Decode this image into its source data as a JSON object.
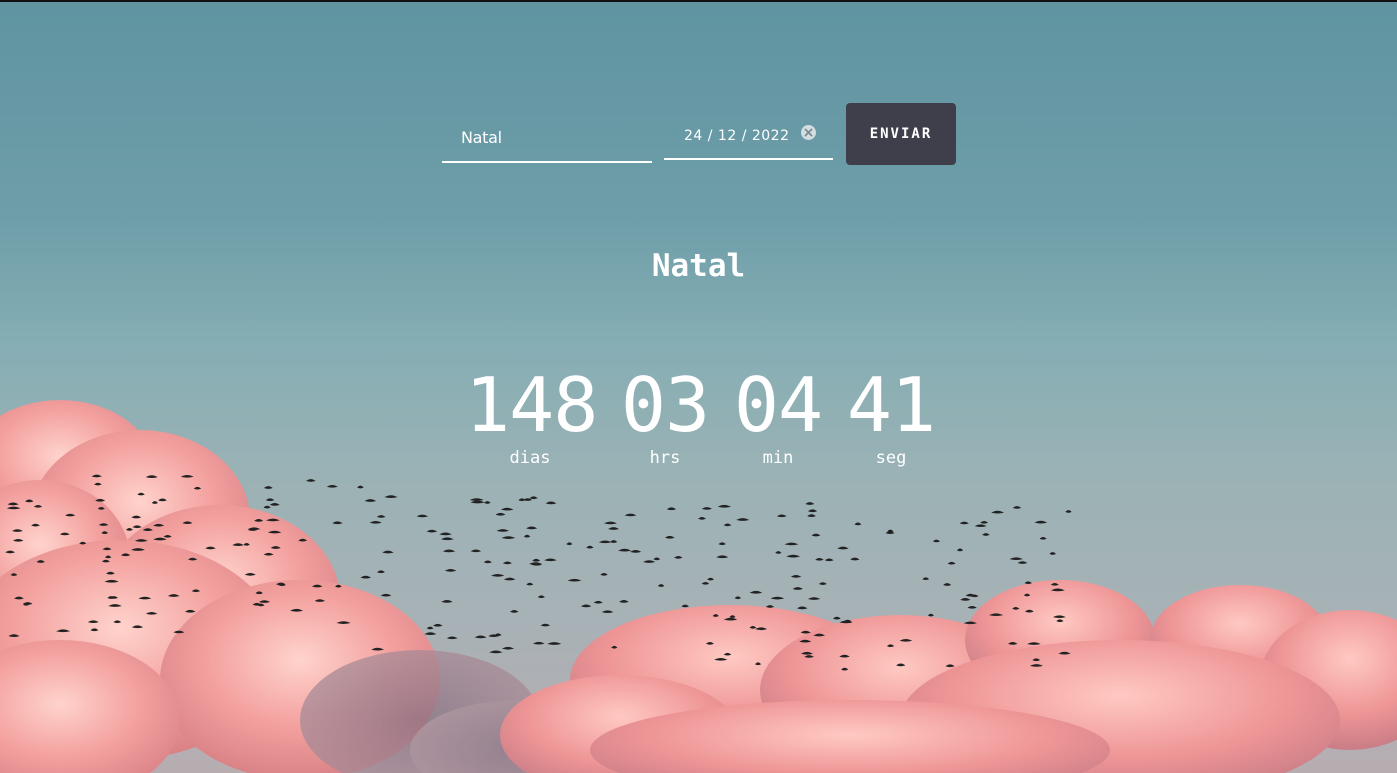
{
  "form": {
    "event_name_value": "Natal",
    "date_value": "24 / 12 / 2022",
    "submit_label": "ENVIAR"
  },
  "event": {
    "title": "Natal"
  },
  "countdown": {
    "days": "148",
    "hours": "03",
    "minutes": "04",
    "seconds": "41",
    "days_label": "dias",
    "hours_label": "hrs",
    "minutes_label": "min",
    "seconds_label": "seg"
  },
  "colors": {
    "button_bg": "#3e3f4b",
    "text": "#ffffff",
    "sky_top": "#5f94a1",
    "cloud_pink": "#f29a9a"
  },
  "icons": {
    "clear": "clear-icon"
  }
}
